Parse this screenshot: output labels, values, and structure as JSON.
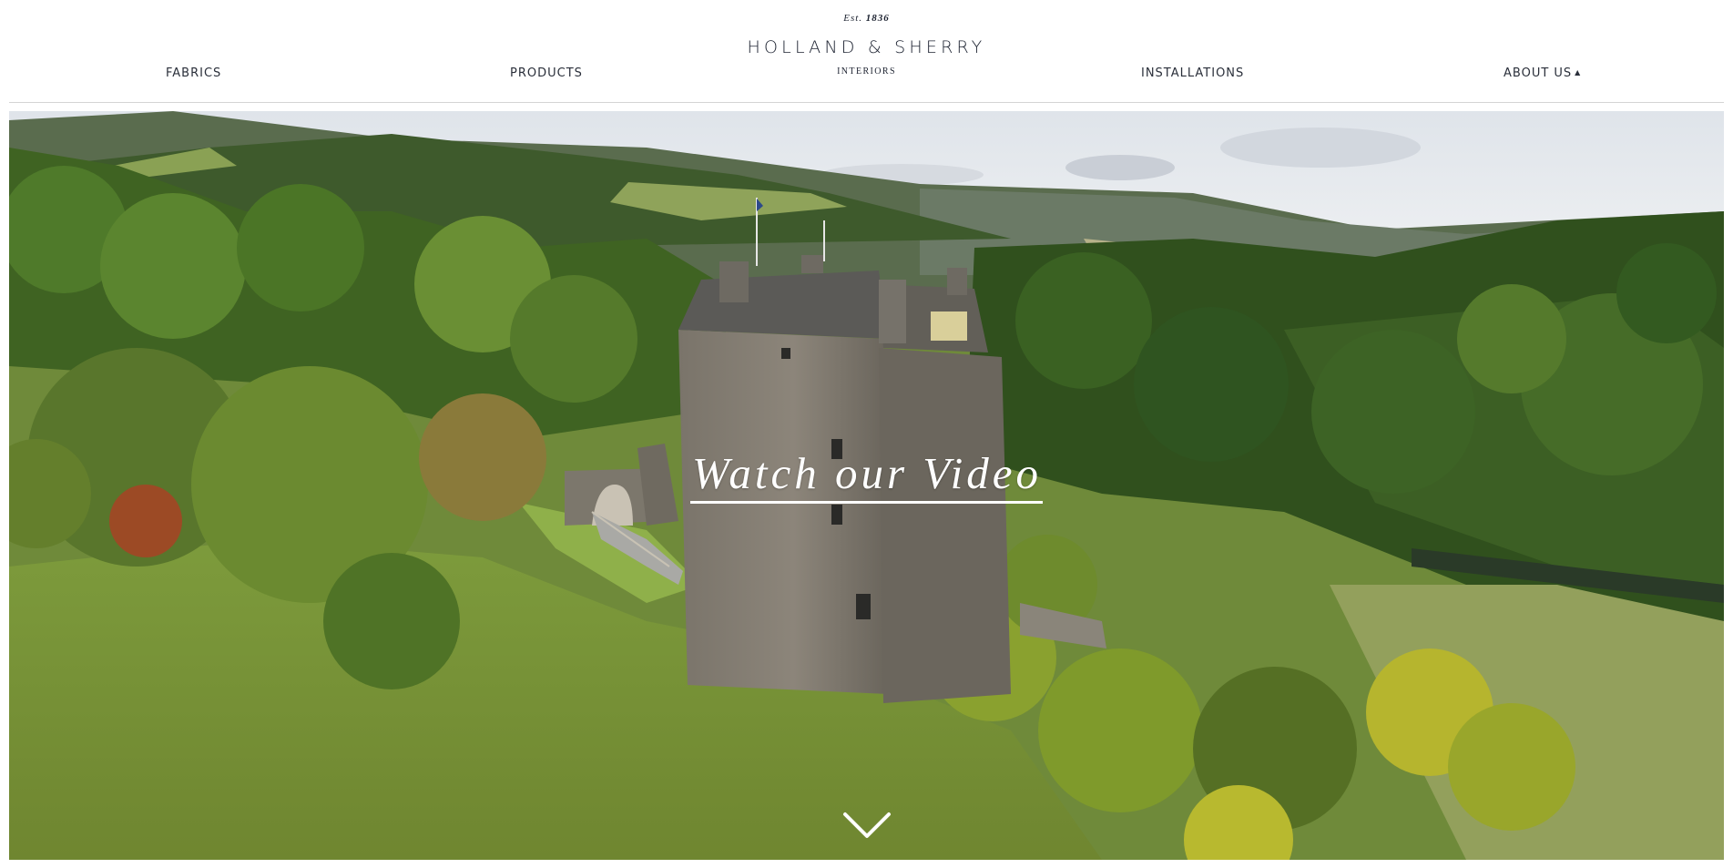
{
  "brand": {
    "est_prefix": "Est.",
    "est_year": "1836",
    "name": "HOLLAND & SHERRY",
    "sub": "INTERIORS"
  },
  "nav": {
    "fabrics": "FABRICS",
    "products": "PRODUCTS",
    "installations": "INSTALLATIONS",
    "about": "ABOUT US",
    "about_caret": "▲"
  },
  "hero": {
    "cta": "Watch our Video",
    "scroll_icon": "chevron-down-icon",
    "image": "castle-landscape"
  },
  "colors": {
    "text": "#1c2230",
    "divider": "#d4d4d4",
    "cta": "#ffffff"
  }
}
